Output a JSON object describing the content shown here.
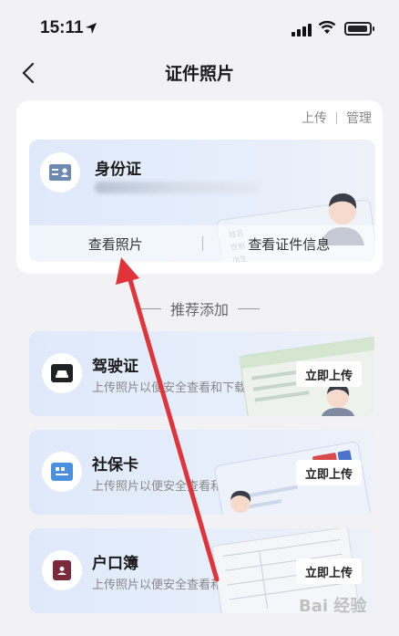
{
  "status": {
    "time": "15:11"
  },
  "nav": {
    "title": "证件照片"
  },
  "top_links": {
    "upload": "上传",
    "manage": "管理"
  },
  "id_card": {
    "title": "身份证",
    "view_photo": "查看照片",
    "view_info": "查看证件信息",
    "illus_labels": {
      "name": "姓名",
      "gender": "性别",
      "nation": "民族",
      "birth": "出生",
      "address": "住址"
    }
  },
  "recommend": {
    "section_title": "推荐添加",
    "items": [
      {
        "name": "驾驶证",
        "desc": "上传照片以便安全查看和下载",
        "button": "立即上传",
        "icon": "car-icon",
        "icon_color": "#1f2124"
      },
      {
        "name": "社保卡",
        "desc": "上传照片以便安全查看和下载",
        "button": "立即上传",
        "icon": "social-card-icon",
        "icon_color": "#4a8fe0"
      },
      {
        "name": "户口簿",
        "desc": "上传照片以便安全查看和下载",
        "button": "立即上传",
        "icon": "household-book-icon",
        "icon_color": "#7a2a3a"
      }
    ]
  },
  "watermark": "Bai 经验",
  "colors": {
    "arrow": "#e0343a",
    "card_bg": "#e3ecfa"
  }
}
